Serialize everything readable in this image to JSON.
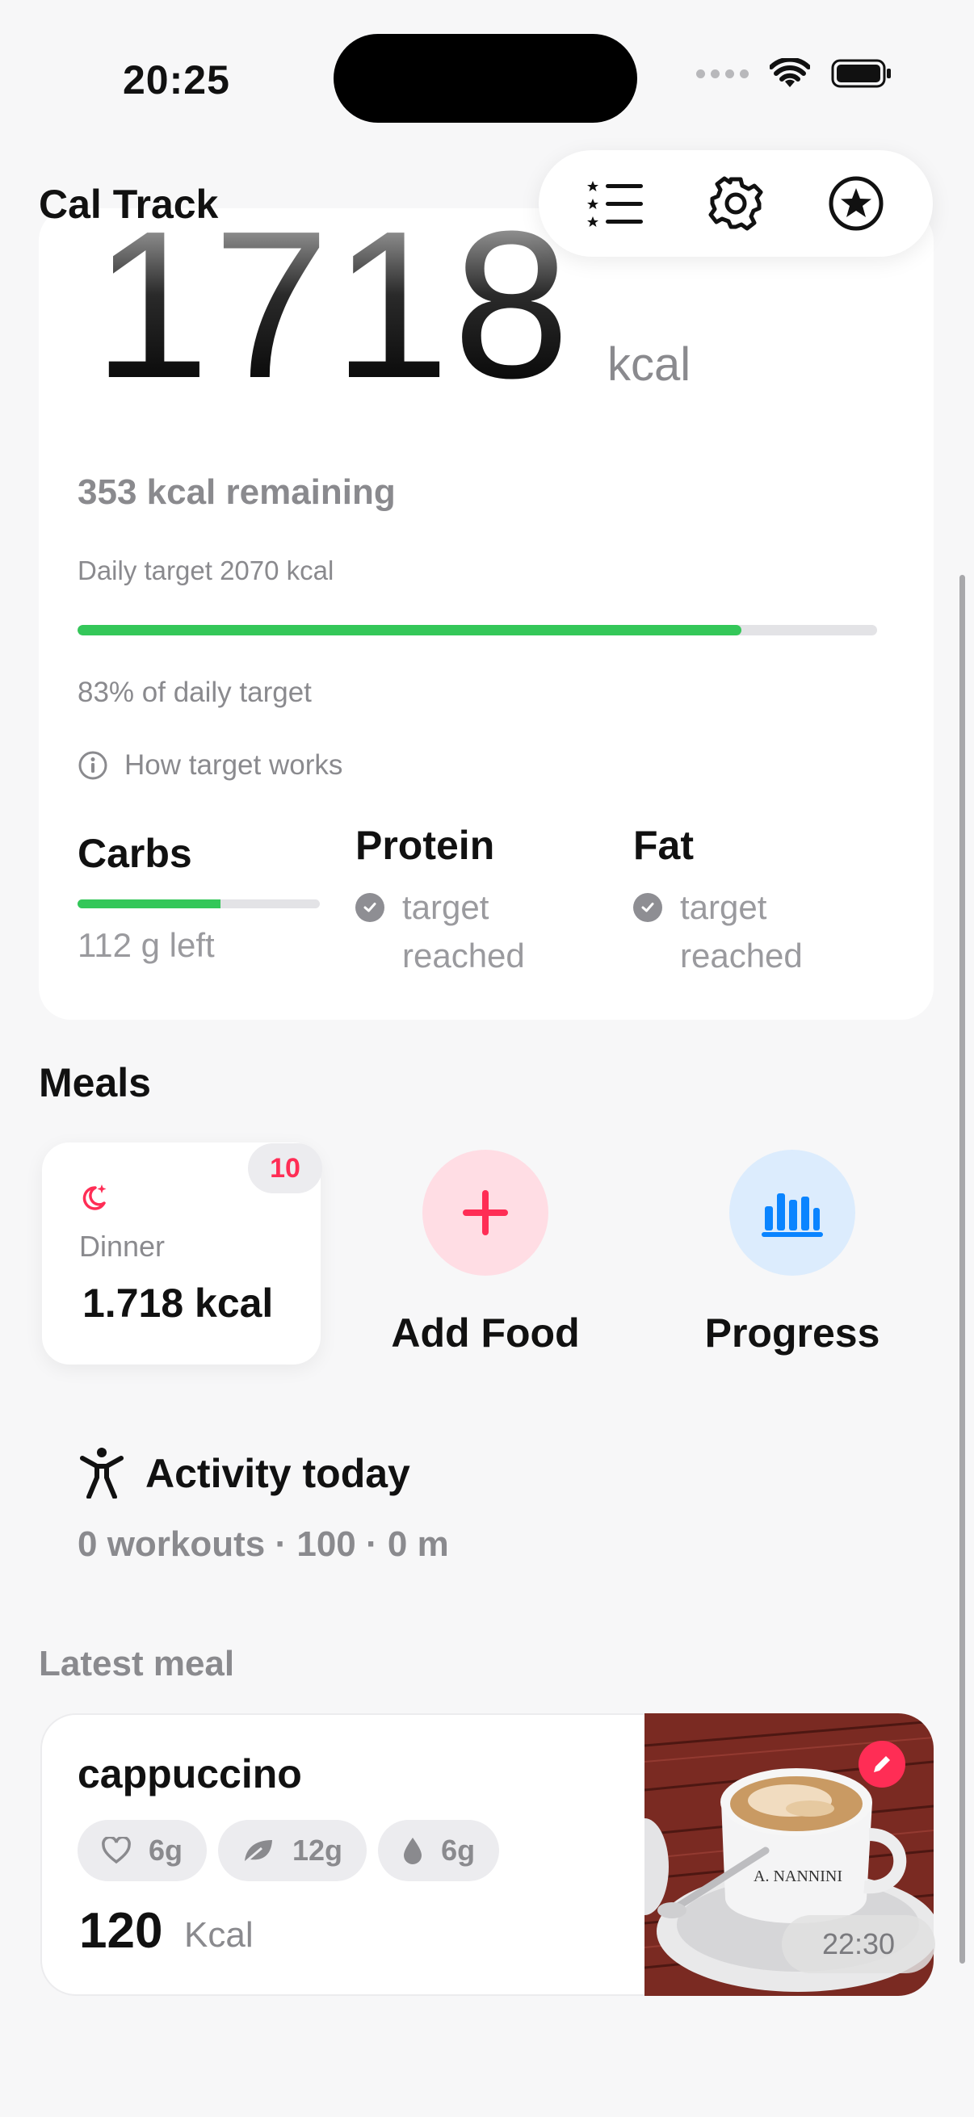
{
  "status_bar": {
    "time": "20:25"
  },
  "header": {
    "title": "Cal Track",
    "toolbar": {
      "list_icon": "list-star-icon",
      "settings_icon": "gear-icon",
      "favorites_icon": "star-circle-icon"
    }
  },
  "summary": {
    "calories_consumed": "1718",
    "unit": "kcal",
    "remaining": "353 kcal remaining",
    "daily_target": "Daily target 2070 kcal",
    "progress_fraction": 0.83,
    "percent_label": "83% of daily target",
    "how_target_works": "How target works",
    "macros": {
      "carbs": {
        "title": "Carbs",
        "status": "112 g left",
        "progress_fraction": 0.59
      },
      "protein": {
        "title": "Protein",
        "status": "target reached"
      },
      "fat": {
        "title": "Fat",
        "status": "target reached"
      }
    }
  },
  "meals": {
    "title": "Meals",
    "card": {
      "name": "Dinner",
      "calories": "1.718 kcal",
      "count": "10",
      "icon": "moon-stars-icon"
    },
    "add_food": {
      "label": "Add Food",
      "icon": "plus-icon"
    },
    "progress": {
      "label": "Progress",
      "icon": "bar-chart-icon"
    }
  },
  "activity": {
    "title": "Activity today",
    "summary": "0 workouts · 100 · 0 m",
    "icon": "person-arms-up-icon"
  },
  "latest_meal": {
    "section_label": "Latest meal",
    "name": "cappuccino",
    "macros": [
      {
        "icon": "heart-icon",
        "value": "6g"
      },
      {
        "icon": "leaf-icon",
        "value": "12g"
      },
      {
        "icon": "drop-icon",
        "value": "6g"
      }
    ],
    "calories": "120",
    "calories_unit": "Kcal",
    "time": "22:30",
    "cup_text": "A. NANNINI"
  },
  "colors": {
    "accent_green": "#34c759",
    "accent_pink": "#ff2d55",
    "accent_blue": "#0a84ff"
  }
}
